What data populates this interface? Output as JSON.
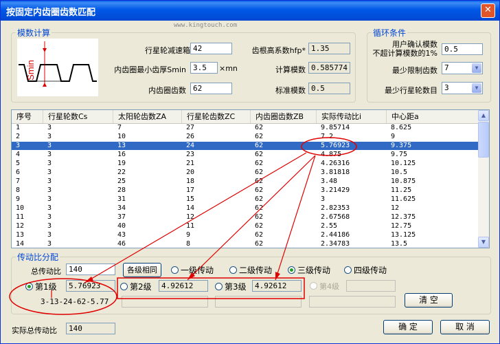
{
  "window": {
    "title": "按固定内齿圈齿数匹配",
    "close_glyph": "✕",
    "watermark": "www.kingtouch.com"
  },
  "modulus": {
    "legend": "模数计算",
    "diagram_label": "Smin",
    "outer_diameter_label": "行星轮减速箱外径",
    "outer_diameter_value": "42",
    "min_thickness_label": "内齿圈最小齿厚Smin",
    "min_thickness_value": "3.5",
    "min_thickness_unit": "×mn",
    "ring_teeth_label": "内齿圈齿数",
    "ring_teeth_value": "62",
    "hfp_label": "齿根高系数hfp*",
    "hfp_value": "1.35",
    "calc_modulus_label": "计算模数",
    "calc_modulus_value": "0.585774",
    "std_modulus_label": "标准模数",
    "std_modulus_value": "0.5"
  },
  "loop": {
    "legend": "循环条件",
    "confirm_line1": "用户确认模数",
    "confirm_line2": "不超计算模数的1%",
    "confirm_value": "0.5",
    "min_teeth_label": "最少限制齿数",
    "min_teeth_value": "7",
    "min_planets_label": "最少行星轮数目",
    "min_planets_value": "3"
  },
  "table": {
    "columns": [
      "序号",
      "行星轮数Cs",
      "太阳轮齿数ZA",
      "行星轮齿数ZC",
      "内齿圈齿数ZB",
      "实际传动比i",
      "中心距a"
    ],
    "selected_index": 2,
    "rows": [
      [
        "1",
        "3",
        "7",
        "27",
        "62",
        "9.85714",
        "8.625"
      ],
      [
        "2",
        "3",
        "10",
        "26",
        "62",
        "7.2",
        "9"
      ],
      [
        "3",
        "3",
        "13",
        "24",
        "62",
        "5.76923",
        "9.375"
      ],
      [
        "4",
        "3",
        "16",
        "23",
        "62",
        "4.875",
        "9.75"
      ],
      [
        "5",
        "3",
        "19",
        "21",
        "62",
        "4.26316",
        "10.125"
      ],
      [
        "6",
        "3",
        "22",
        "20",
        "62",
        "3.81818",
        "10.5"
      ],
      [
        "7",
        "3",
        "25",
        "18",
        "62",
        "3.48",
        "10.875"
      ],
      [
        "8",
        "3",
        "28",
        "17",
        "62",
        "3.21429",
        "11.25"
      ],
      [
        "9",
        "3",
        "31",
        "15",
        "62",
        "3",
        "11.625"
      ],
      [
        "10",
        "3",
        "34",
        "14",
        "62",
        "2.82353",
        "12"
      ],
      [
        "11",
        "3",
        "37",
        "12",
        "62",
        "2.67568",
        "12.375"
      ],
      [
        "12",
        "3",
        "40",
        "11",
        "62",
        "2.55",
        "12.75"
      ],
      [
        "13",
        "3",
        "43",
        "9",
        "62",
        "2.44186",
        "13.125"
      ],
      [
        "14",
        "3",
        "46",
        "8",
        "62",
        "2.34783",
        "13.5"
      ]
    ]
  },
  "distribution": {
    "legend": "传动比分配",
    "total_ratio_label": "总传动比",
    "total_ratio_value": "140",
    "same_button": "各级相同",
    "stage_options": [
      "一级传动",
      "二级传动",
      "三级传动",
      "四级传动"
    ],
    "stage_selected": 2,
    "stage1_label": "第1级",
    "stage1_value": "5.76923",
    "stage1_combo": "3-13-24-62-5.77",
    "stage2_label": "第2级",
    "stage2_value": "4.92612",
    "stage3_label": "第3级",
    "stage3_value": "4.92612",
    "stage4_label": "第4级",
    "stage4_value": "",
    "clear_button": "清  空"
  },
  "footer": {
    "actual_ratio_label": "实际总传动比",
    "actual_ratio_value": "140",
    "ok_button": "确  定",
    "cancel_button": "取  消"
  },
  "colors": {
    "accent": "#0046d5",
    "selection": "#316ac5",
    "annotation_red": "#e00000"
  },
  "icons": {
    "scroll_up": "▲",
    "scroll_down": "▼",
    "dropdown": "▼"
  }
}
